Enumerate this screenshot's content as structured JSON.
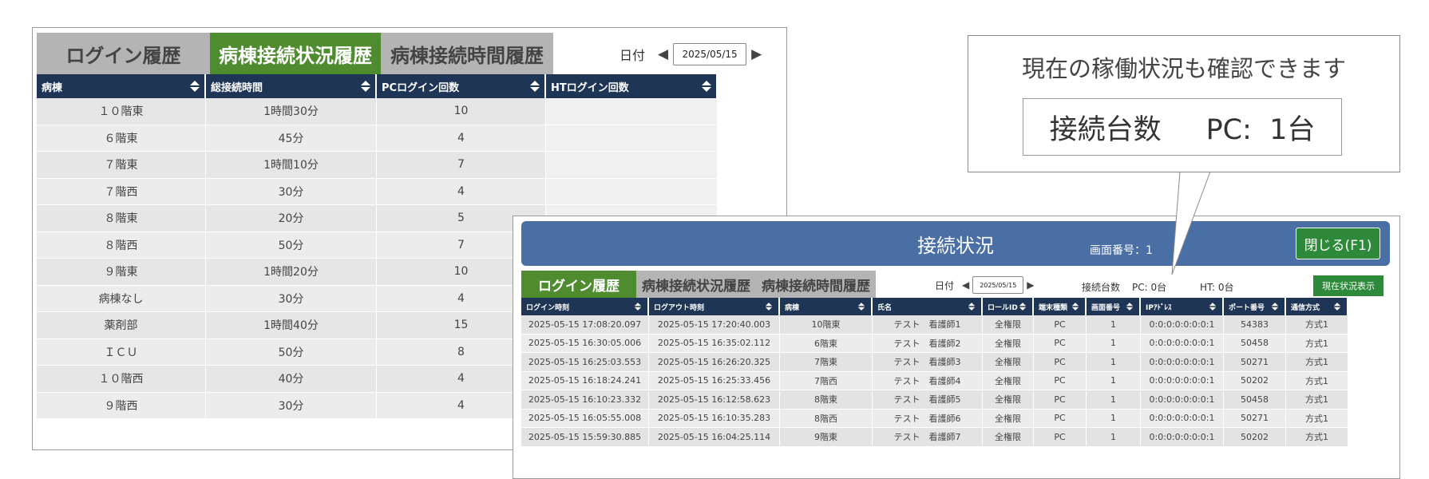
{
  "back": {
    "tabs": [
      "ログイン履歴",
      "病棟接続状況履歴",
      "病棟接続時間履歴"
    ],
    "active_tab": 1,
    "date_label": "日付",
    "date_value": "2025/05/15",
    "columns": [
      "病棟",
      "総接続時間",
      "PCログイン回数",
      "HTログイン回数"
    ],
    "rows": [
      [
        "１０階東",
        "1時間30分",
        "10",
        ""
      ],
      [
        "６階東",
        "45分",
        "4",
        ""
      ],
      [
        "７階東",
        "1時間10分",
        "7",
        ""
      ],
      [
        "７階西",
        "30分",
        "4",
        ""
      ],
      [
        "８階東",
        "20分",
        "5",
        ""
      ],
      [
        "８階西",
        "50分",
        "7",
        ""
      ],
      [
        "９階東",
        "1時間20分",
        "10",
        ""
      ],
      [
        "病棟なし",
        "30分",
        "4",
        ""
      ],
      [
        "薬剤部",
        "1時間40分",
        "15",
        ""
      ],
      [
        "ＩＣＵ",
        "50分",
        "8",
        ""
      ],
      [
        "１０階西",
        "40分",
        "4",
        ""
      ],
      [
        "９階西",
        "30分",
        "4",
        ""
      ]
    ]
  },
  "front": {
    "title": "接続状況",
    "screen_number": "画面番号：1",
    "close_button": "閉じる(F1)",
    "tabs": [
      "ログイン履歴",
      "病棟接続状況履歴",
      "病棟接続時間履歴"
    ],
    "active_tab": 0,
    "date_label": "日付",
    "date_value": "2025/05/15",
    "connected_label": "接続台数",
    "pc_count": "PC: 0台",
    "ht_count": "HT: 0台",
    "current_button": "現在状況表示",
    "columns": [
      "ログイン時刻",
      "ログアウト時刻",
      "病棟",
      "氏名",
      "ロールID",
      "端末種類",
      "画面番号",
      "IPｱﾄﾞﾚｽ",
      "ポート番号",
      "通信方式"
    ],
    "rows": [
      [
        "2025-05-15 17:08:20.097",
        "2025-05-15 17:20:40.003",
        "10階東",
        "テスト　看護師1",
        "全権限",
        "PC",
        "1",
        "0:0:0:0:0:0:0:1",
        "54383",
        "方式1"
      ],
      [
        "2025-05-15 16:30:05.006",
        "2025-05-15 16:35:02.112",
        "6階東",
        "テスト　看護師2",
        "全権限",
        "PC",
        "1",
        "0:0:0:0:0:0:0:1",
        "50458",
        "方式1"
      ],
      [
        "2025-05-15 16:25:03.553",
        "2025-05-15 16:26:20.325",
        "7階東",
        "テスト　看護師3",
        "全権限",
        "PC",
        "1",
        "0:0:0:0:0:0:0:1",
        "50271",
        "方式1"
      ],
      [
        "2025-05-15 16:18:24.241",
        "2025-05-15 16:25:33.456",
        "7階西",
        "テスト　看護師4",
        "全権限",
        "PC",
        "1",
        "0:0:0:0:0:0:0:1",
        "50202",
        "方式1"
      ],
      [
        "2025-05-15 16:10:23.332",
        "2025-05-15 16:12:58.623",
        "8階東",
        "テスト　看護師5",
        "全権限",
        "PC",
        "1",
        "0:0:0:0:0:0:0:1",
        "50458",
        "方式1"
      ],
      [
        "2025-05-15 16:05:55.008",
        "2025-05-15 16:10:35.283",
        "8階西",
        "テスト　看護師6",
        "全権限",
        "PC",
        "1",
        "0:0:0:0:0:0:0:1",
        "50271",
        "方式1"
      ],
      [
        "2025-05-15 15:59:30.885",
        "2025-05-15 16:04:25.114",
        "9階東",
        "テスト　看護師7",
        "全権限",
        "PC",
        "1",
        "0:0:0:0:0:0:0:1",
        "50202",
        "方式1"
      ]
    ]
  },
  "callout": {
    "title": "現在の稼働状況も確認できます",
    "label": "接続台数",
    "value": "PC:  1台"
  },
  "colors": {
    "header_bg": "#1f3556",
    "active_tab": "#4e8c2f",
    "inactive_tab": "#b4b4b4",
    "title_bar": "#4a6fa5",
    "green_button": "#2e8a3a"
  }
}
